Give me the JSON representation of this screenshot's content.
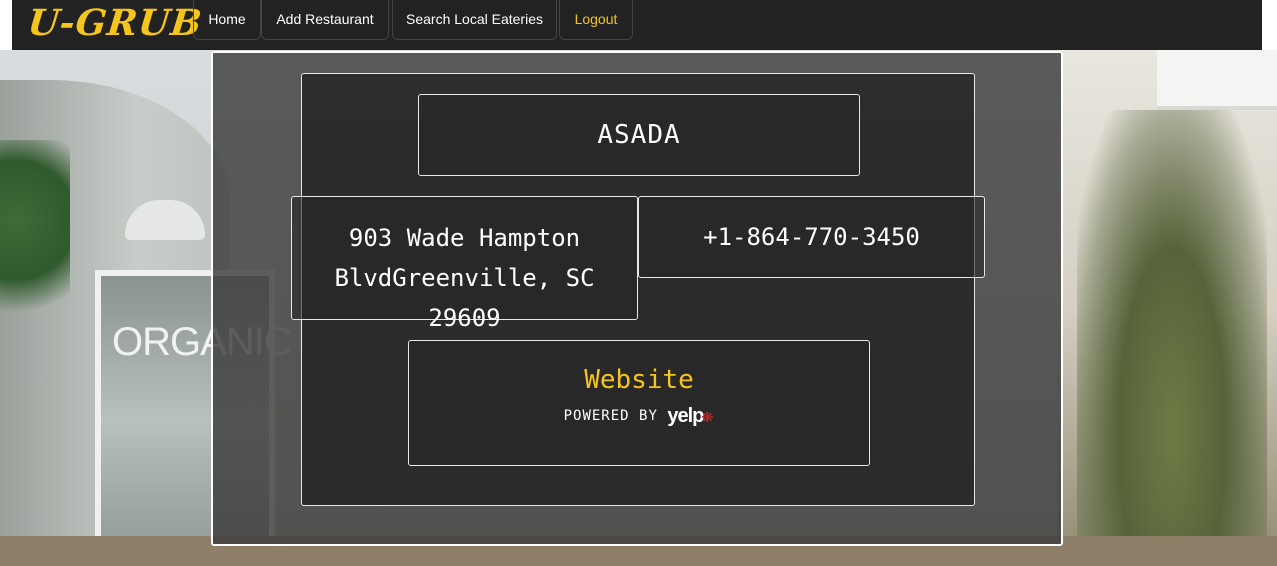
{
  "nav": {
    "brand": "U-GRUB",
    "items": [
      {
        "label": "Home"
      },
      {
        "label": "Add Restaurant"
      },
      {
        "label": "Search Local Eateries"
      },
      {
        "label": "Logout"
      }
    ]
  },
  "background": {
    "sign_text": "ORGANIC"
  },
  "restaurant": {
    "name": "ASADA",
    "address": "903 Wade Hampton BlvdGreenville, SC 29609",
    "phone": "+1-864-770-3450",
    "website_label": "Website",
    "powered_by": "POWERED BY",
    "yelp_logo": "yelp"
  },
  "colors": {
    "accent": "#f6c51c",
    "navbar": "#222222",
    "yelp_red": "#d32323"
  },
  "icons": {
    "yelp_burst": "yelp-burst-icon"
  }
}
